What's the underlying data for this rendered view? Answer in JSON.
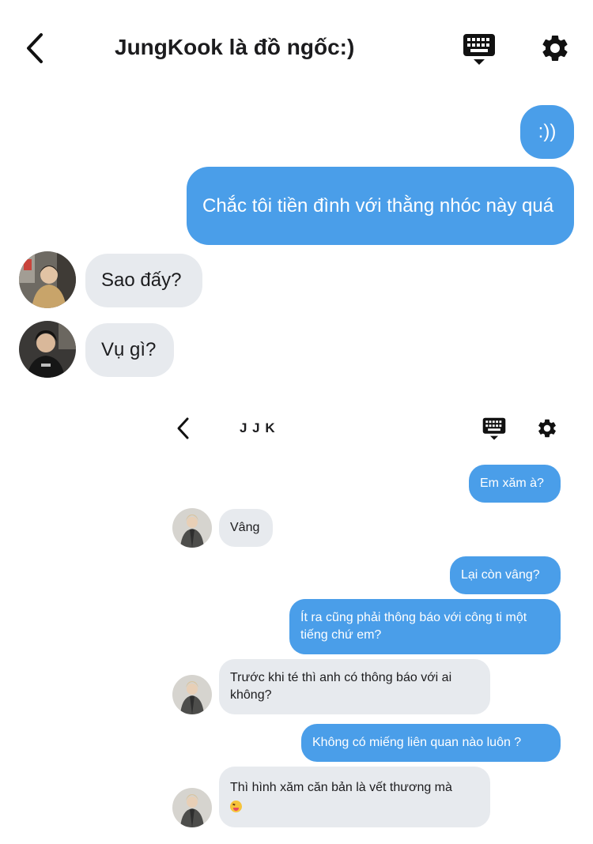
{
  "chat1": {
    "title": "JungKook là đồ ngốc:)",
    "messages": [
      {
        "side": "out",
        "text": ":))"
      },
      {
        "side": "out",
        "text": "Chắc tôi tiền đình với thằng nhóc này quá"
      },
      {
        "side": "in",
        "text": "Sao đấy?"
      },
      {
        "side": "in",
        "text": "Vụ gì?"
      }
    ]
  },
  "chat2": {
    "title": "J J K",
    "messages": [
      {
        "side": "out",
        "text": "Em xăm à?"
      },
      {
        "side": "in",
        "text": "Vâng"
      },
      {
        "side": "out",
        "text": "Lại còn vâng?"
      },
      {
        "side": "out",
        "text": "Ít ra cũng phải thông báo với công ti một tiếng chứ em?"
      },
      {
        "side": "in",
        "text": "Trước khi té thì anh có thông báo với ai không?"
      },
      {
        "side": "out",
        "text": "Không có miếng liên quan nào luôn ?"
      },
      {
        "side": "in",
        "text": "Thì hình xăm căn bản là vết thương mà"
      }
    ]
  },
  "icons": {
    "back": "chevron-left-icon",
    "keyboard": "keyboard-icon",
    "settings": "gear-icon",
    "emoji": "squinting-tongue-emoji-icon"
  },
  "colors": {
    "outgoing_bubble": "#4a9ee9",
    "incoming_bubble": "#e7eaee",
    "text": "#1c1c1e"
  }
}
